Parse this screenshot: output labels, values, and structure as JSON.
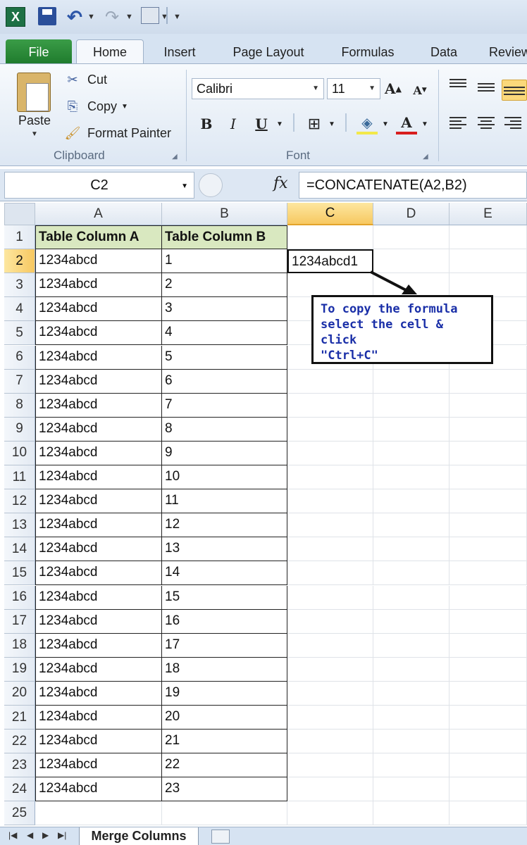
{
  "qat": {
    "app_icon": "excel-icon",
    "items": [
      "save-icon",
      "undo-icon",
      "redo-icon",
      "form-icon"
    ]
  },
  "tabs": [
    "File",
    "Home",
    "Insert",
    "Page Layout",
    "Formulas",
    "Data",
    "Review"
  ],
  "clipboard": {
    "paste": "Paste",
    "cut": "Cut",
    "copy": "Copy",
    "format_painter": "Format Painter",
    "label": "Clipboard"
  },
  "font": {
    "name": "Calibri",
    "size": "11",
    "label": "Font",
    "bold": "B",
    "italic": "I",
    "underline": "U",
    "grow": "A",
    "shrink": "A",
    "font_color": "A"
  },
  "formula_bar": {
    "name_box": "C2",
    "fx": "fx",
    "formula": "=CONCATENATE(A2,B2)"
  },
  "columns": [
    "A",
    "B",
    "C",
    "D",
    "E"
  ],
  "rows": [
    {
      "n": "1",
      "a": "Table Column A",
      "b": "Table Column B"
    },
    {
      "n": "2",
      "a": "1234abcd",
      "b": "1",
      "c": "1234abcd1"
    },
    {
      "n": "3",
      "a": "1234abcd",
      "b": "2"
    },
    {
      "n": "4",
      "a": "1234abcd",
      "b": "3"
    },
    {
      "n": "5",
      "a": "1234abcd",
      "b": "4"
    },
    {
      "n": "6",
      "a": "1234abcd",
      "b": "5"
    },
    {
      "n": "7",
      "a": "1234abcd",
      "b": "6"
    },
    {
      "n": "8",
      "a": "1234abcd",
      "b": "7"
    },
    {
      "n": "9",
      "a": "1234abcd",
      "b": "8"
    },
    {
      "n": "10",
      "a": "1234abcd",
      "b": "9"
    },
    {
      "n": "11",
      "a": "1234abcd",
      "b": "10"
    },
    {
      "n": "12",
      "a": "1234abcd",
      "b": "11"
    },
    {
      "n": "13",
      "a": "1234abcd",
      "b": "12"
    },
    {
      "n": "14",
      "a": "1234abcd",
      "b": "13"
    },
    {
      "n": "15",
      "a": "1234abcd",
      "b": "14"
    },
    {
      "n": "16",
      "a": "1234abcd",
      "b": "15"
    },
    {
      "n": "17",
      "a": "1234abcd",
      "b": "16"
    },
    {
      "n": "18",
      "a": "1234abcd",
      "b": "17"
    },
    {
      "n": "19",
      "a": "1234abcd",
      "b": "18"
    },
    {
      "n": "20",
      "a": "1234abcd",
      "b": "19"
    },
    {
      "n": "21",
      "a": "1234abcd",
      "b": "20"
    },
    {
      "n": "22",
      "a": "1234abcd",
      "b": "21"
    },
    {
      "n": "23",
      "a": "1234abcd",
      "b": "22"
    },
    {
      "n": "24",
      "a": "1234abcd",
      "b": "23"
    },
    {
      "n": "25"
    }
  ],
  "callout": {
    "line1": "To copy the formula",
    "line2": "select the cell & click",
    "line3": "\"Ctrl+C\""
  },
  "sheet_tabs": {
    "active": "Merge Columns"
  },
  "colors": {
    "header_fill": "#d9e8c0",
    "callout_text": "#1a2fa8",
    "selected_header": "#f7c861"
  }
}
